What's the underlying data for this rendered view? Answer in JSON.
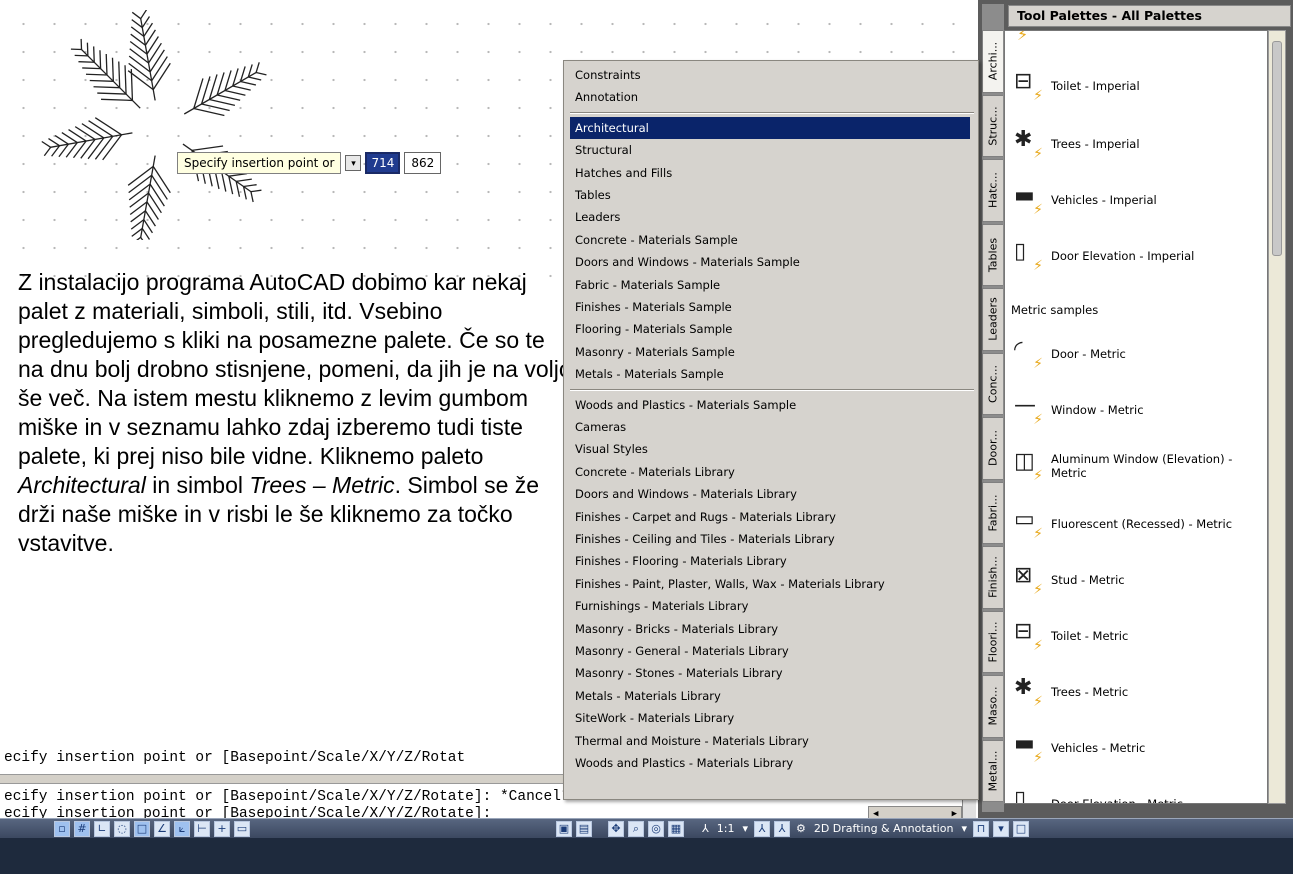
{
  "dynamic_input": {
    "prompt": "Specify insertion point or",
    "arrow_icon": "down-arrow-icon",
    "x_value": "714",
    "y_value": "862"
  },
  "description": {
    "text_before_1": "Z instalacijo programa AutoCAD dobimo kar nekaj palet z materiali, simboli, stili, itd. Vsebino pregledujemo s kliki na posamezne palete. Če so te na dnu bolj drobno stisnjene, pomeni, da jih je na voljo še več. Na istem mestu kliknemo z levim gumbom miške in v seznamu lahko zdaj izberemo tudi tiste palete, ki prej niso bile vidne. Kliknemo paleto ",
    "italic_1": "Architectural",
    "text_between": " in simbol ",
    "italic_2": "Trees – Metric",
    "text_after": ". Simbol se že drži naše miške in v risbi le še kliknemo za točko vstavitve."
  },
  "command_line": {
    "line1": "ecify insertion point or [Basepoint/Scale/X/Y/Z/Rotat",
    "line2": "ecify insertion point or [Basepoint/Scale/X/Y/Z/Rotate]: *Cancel*",
    "line3": "ecify insertion point or [Basepoint/Scale/X/Y/Z/Rotate]:"
  },
  "menu": {
    "group1": [
      "Constraints",
      "Annotation"
    ],
    "group2": [
      "Architectural",
      "Structural",
      "Hatches and Fills",
      "Tables",
      "Leaders",
      "Concrete - Materials Sample",
      "Doors and Windows - Materials Sample",
      "Fabric - Materials Sample",
      "Finishes - Materials Sample",
      "Flooring - Materials Sample",
      "Masonry - Materials Sample",
      "Metals - Materials Sample"
    ],
    "group3": [
      "Woods and Plastics - Materials Sample",
      "Cameras",
      "Visual Styles",
      "Concrete - Materials Library",
      "Doors and Windows - Materials Library",
      "Finishes - Carpet and Rugs - Materials Library",
      "Finishes - Ceiling and Tiles - Materials Library",
      "Finishes - Flooring - Materials Library",
      "Finishes - Paint, Plaster, Walls, Wax - Materials Library",
      "Furnishings - Materials Library",
      "Masonry - Bricks - Materials Library",
      "Masonry - General - Materials Library",
      "Masonry - Stones - Materials Library",
      "Metals - Materials Library",
      "SiteWork - Materials Library",
      "Thermal and Moisture - Materials Library",
      "Woods and Plastics - Materials Library"
    ],
    "selected": "Architectural"
  },
  "palette": {
    "title": "Tool Palettes - All Palettes",
    "tabs": [
      "Archi...",
      "Struc...",
      "Hatc...",
      "Tables",
      "Leaders",
      "Conc...",
      "Door...",
      "Fabri...",
      "Finish...",
      "Floori...",
      "Maso...",
      "Metal..."
    ],
    "active_tab": "Archi...",
    "section_label": "Metric samples",
    "tools_imperial": [
      {
        "name": "Toilet - Imperial",
        "icon": "toilet-icon"
      },
      {
        "name": "Trees - Imperial",
        "icon": "tree-icon"
      },
      {
        "name": "Vehicles - Imperial",
        "icon": "vehicle-icon"
      },
      {
        "name": "Door Elevation - Imperial",
        "icon": "door-elevation-icon"
      }
    ],
    "tools_metric": [
      {
        "name": "Door - Metric",
        "icon": "door-icon"
      },
      {
        "name": "Window - Metric",
        "icon": "window-icon"
      },
      {
        "name": "Aluminum Window (Elevation) - Metric",
        "icon": "aluminum-window-icon"
      },
      {
        "name": "Fluorescent (Recessed) - Metric",
        "icon": "fluorescent-icon"
      },
      {
        "name": "Stud - Metric",
        "icon": "stud-icon"
      },
      {
        "name": "Toilet - Metric",
        "icon": "toilet-icon"
      },
      {
        "name": "Trees - Metric",
        "icon": "tree-icon"
      },
      {
        "name": "Vehicles - Metric",
        "icon": "vehicle-icon"
      },
      {
        "name": "Door Elevation - Metric",
        "icon": "door-elevation-icon"
      }
    ]
  },
  "statusbar": {
    "scale": "1:1",
    "workspace": "2D Drafting & Annotation"
  }
}
